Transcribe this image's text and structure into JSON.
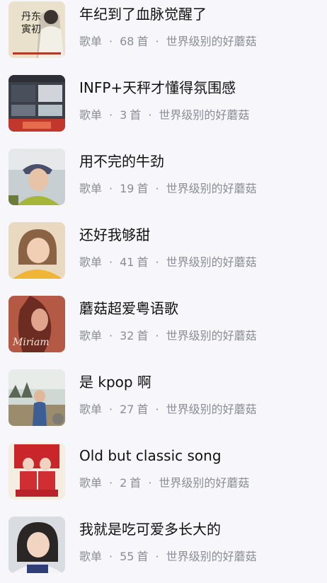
{
  "playlists": [
    {
      "title": "年纪到了血脉觉醒了",
      "type": "歌单",
      "count": "68",
      "unit": "首",
      "creator": "世界级别的好蘑菇",
      "cover_text": "丹东寅初",
      "cover_icon": "book-cover-icon"
    },
    {
      "title": "INFP+天秤才懂得氛围感",
      "type": "歌单",
      "count": "3",
      "unit": "首",
      "creator": "世界级别的好蘑菇",
      "cover_icon": "collage-cover-icon"
    },
    {
      "title": "用不完的牛劲",
      "type": "歌单",
      "count": "19",
      "unit": "首",
      "creator": "世界级别的好蘑菇",
      "cover_icon": "portrait-cover-icon"
    },
    {
      "title": "还好我够甜",
      "type": "歌单",
      "count": "41",
      "unit": "首",
      "creator": "世界级别的好蘑菇",
      "cover_icon": "portrait-cover-icon"
    },
    {
      "title": "蘑菇超爱粤语歌",
      "type": "歌单",
      "count": "32",
      "unit": "首",
      "creator": "世界级别的好蘑菇",
      "cover_text": "Miriam",
      "cover_icon": "album-cover-icon"
    },
    {
      "title": "是 kpop 啊",
      "type": "歌单",
      "count": "27",
      "unit": "首",
      "creator": "世界级别的好蘑菇",
      "cover_icon": "photo-cover-icon"
    },
    {
      "title": "Old but classic song",
      "type": "歌单",
      "count": "2",
      "unit": "首",
      "creator": "世界级别的好蘑菇",
      "cover_icon": "poster-cover-icon"
    },
    {
      "title": "我就是吃可爱多长大的",
      "type": "歌单",
      "count": "55",
      "unit": "首",
      "creator": "世界级别的好蘑菇",
      "cover_icon": "portrait-cover-icon"
    }
  ],
  "colors": {
    "background": "#f7f7fb",
    "title": "#111111",
    "meta": "#8c8c96"
  }
}
